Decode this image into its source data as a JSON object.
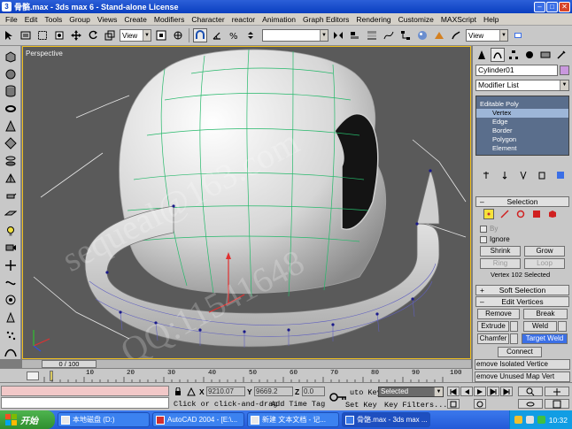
{
  "window": {
    "title": "骨骼.max - 3ds max 6 - Stand-alone License",
    "buttons": [
      "minimize",
      "maximize",
      "close"
    ]
  },
  "menu": [
    "File",
    "Edit",
    "Tools",
    "Group",
    "Views",
    "Create",
    "Modifiers",
    "Character",
    "reactor",
    "Animation",
    "Graph Editors",
    "Rendering",
    "Customize",
    "MAXScript",
    "Help"
  ],
  "toolbar": {
    "view_dropdown": "View",
    "view_dropdown_right": "View",
    "named_selection": ""
  },
  "viewport": {
    "label": "Perspective",
    "watermark_1": "sequeal@163.com",
    "watermark_2": "QQ:11541648"
  },
  "command_panel": {
    "object_name": "Cylinder01",
    "object_color": "#c998de",
    "modifier_list": "Modifier List",
    "stack": [
      {
        "label": "Editable Poly",
        "selected": false,
        "root": true
      },
      {
        "label": "Vertex",
        "selected": true,
        "root": false
      },
      {
        "label": "Edge",
        "selected": false,
        "root": false
      },
      {
        "label": "Border",
        "selected": false,
        "root": false
      },
      {
        "label": "Polygon",
        "selected": false,
        "root": false
      },
      {
        "label": "Element",
        "selected": false,
        "root": false
      }
    ],
    "selection": {
      "title": "Selection",
      "by_vertex": "By",
      "ignore_backfacing": "Ignore",
      "shrink": "Shrink",
      "grow": "Grow",
      "ring": "Ring",
      "loop": "Loop",
      "status": "Vertex 102 Selected"
    },
    "soft_selection": {
      "title": "Soft Selection"
    },
    "edit_vertices": {
      "title": "Edit Vertices",
      "remove": "Remove",
      "break": "Break",
      "extrude": "Extrude",
      "weld": "Weld",
      "chamfer": "Chamfer",
      "target_weld": "Target Weld",
      "connect": "Connect",
      "remove_isolated": "emove Isolated Vertice",
      "remove_unused": "emove Unused Map Vert"
    }
  },
  "timeline": {
    "frame": "0 / 100",
    "ticks": [
      "10",
      "20",
      "30",
      "40",
      "50",
      "60",
      "70",
      "80",
      "90",
      "100"
    ]
  },
  "status": {
    "x_label": "X",
    "x_value": "9210.07",
    "y_label": "Y",
    "y_value": "9669.2",
    "z_label": "Z",
    "z_value": "0.0",
    "prompt": "Click or click-and-drag",
    "add_time_tag": "Add Time Tag",
    "auto_key": "uto Key",
    "selected": "Selected",
    "set_key": "Set Key",
    "key_filters": "Key Filters..."
  },
  "taskbar": {
    "start": "开始",
    "tasks": [
      {
        "label": "本地磁盘 (D:)",
        "active": false
      },
      {
        "label": "AutoCAD 2004 - [E:\\...",
        "active": false
      },
      {
        "label": "新建 文本文档 - 记...",
        "active": false
      },
      {
        "label": "骨骼.max - 3ds max ...",
        "active": true
      }
    ],
    "clock": "10:32",
    "colors": {
      "bar": "#235ad8",
      "start": "#2f8f2f",
      "tray": "#119de4"
    }
  }
}
